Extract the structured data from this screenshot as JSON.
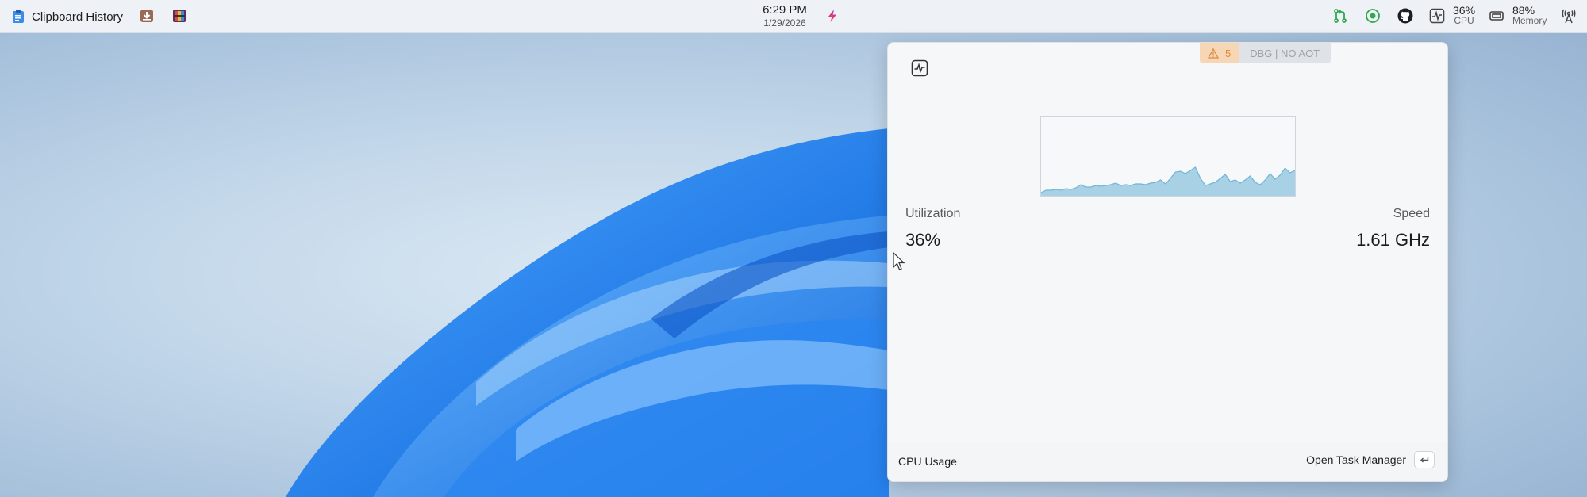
{
  "topbar": {
    "app_title": "Clipboard History",
    "time": "6:29 PM",
    "date": "1/29/2026",
    "cpu_value": "36%",
    "cpu_label": "CPU",
    "memory_value": "88%",
    "memory_label": "Memory",
    "icons": [
      "clipboard-icon",
      "download-icon",
      "winrar-icon",
      "flash-icon",
      "git-pull-request-icon",
      "record-icon",
      "github-icon",
      "activity-icon",
      "memory-icon",
      "antenna-icon"
    ]
  },
  "panel": {
    "warning_count": "5",
    "debug_badge": "DBG | NO AOT",
    "utilization_label": "Utilization",
    "utilization_value": "36%",
    "speed_label": "Speed",
    "speed_value": "1.61 GHz",
    "footer_title": "CPU Usage",
    "open_task_manager_label": "Open Task Manager",
    "chart_color": "#a9d1e6",
    "chart_line_color": "#6fb6d8"
  },
  "chart_data": {
    "type": "area",
    "values": [
      4,
      7,
      7,
      8,
      7,
      9,
      8,
      10,
      14,
      11,
      11,
      13,
      12,
      13,
      14,
      16,
      13,
      14,
      13,
      15,
      15,
      14,
      16,
      17,
      20,
      15,
      22,
      30,
      31,
      28,
      32,
      36,
      22,
      13,
      15,
      17,
      22,
      27,
      18,
      20,
      16,
      20,
      25,
      17,
      14,
      20,
      28,
      21,
      26,
      35,
      29,
      32
    ]
  },
  "accent": {
    "bloom": "#1f7ae8"
  }
}
